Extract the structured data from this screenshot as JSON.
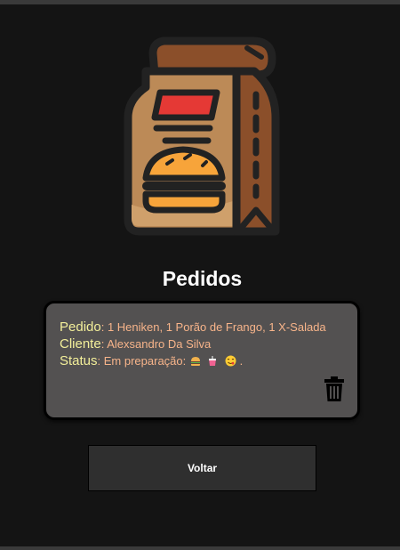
{
  "header": {
    "logo_icon": "paper-bag-burger-icon",
    "title": "Pedidos"
  },
  "order": {
    "pedido_label": "Pedido",
    "pedido_value": "1 Heniken, 1 Porão de Frango, 1 X-Salada",
    "cliente_label": "Cliente",
    "cliente_value": "Alexsandro Da Silva",
    "status_label": "Status",
    "status_value": "Em preparação:",
    "status_icons": [
      "burger-icon",
      "drink-cup-icon",
      "yummy-face-icon"
    ],
    "status_end": ".",
    "delete_icon": "trash-icon"
  },
  "actions": {
    "back_label": "Voltar"
  },
  "colors": {
    "background": "#141414",
    "card": "#535151",
    "label": "#f3ef9a",
    "value": "#f7b48a",
    "button": "#2f2f2f"
  }
}
